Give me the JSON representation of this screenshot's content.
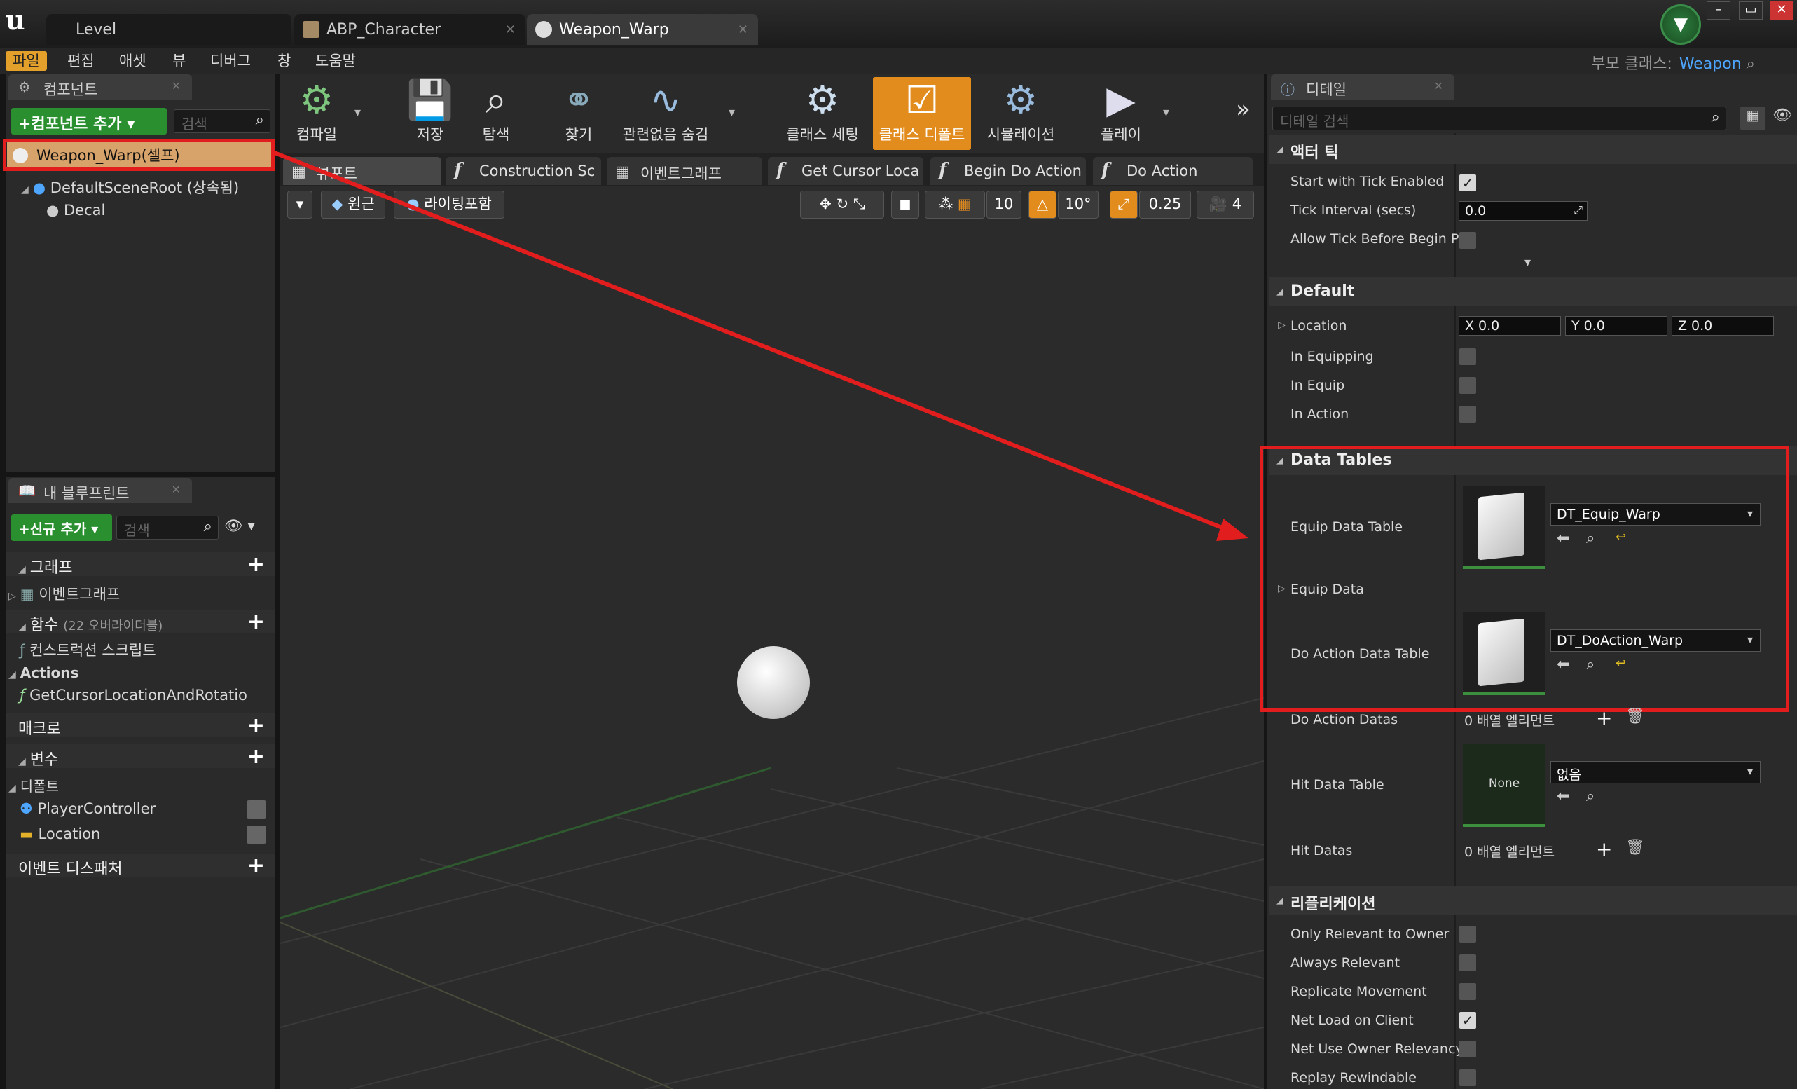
{
  "window": {
    "tabs": [
      {
        "label": "Level"
      },
      {
        "label": "ABP_Character"
      },
      {
        "label": "Weapon_Warp"
      }
    ],
    "parent_class_label": "부모 클래스:",
    "parent_class_value": "Weapon"
  },
  "menubar": [
    "파일",
    "편집",
    "애셋",
    "뷰",
    "디버그",
    "창",
    "도움말"
  ],
  "components": {
    "tab_title": "컴포넌트",
    "add_button": "+컴포넌트 추가",
    "search_placeholder": "검색",
    "items": [
      "Weapon_Warp(셀프)",
      "DefaultSceneRoot (상속됨)",
      "Decal"
    ]
  },
  "my_blueprint": {
    "tab_title": "내 블루프린트",
    "add_button": "+신규 추가",
    "search_placeholder": "검색",
    "graph_header": "그래프",
    "event_graph": "이벤트그래프",
    "functions_header": "함수",
    "functions_override": "(22 오버라이더블)",
    "construction_script": "컨스트럭션 스크립트",
    "actions_category": "Actions",
    "action_function": "GetCursorLocationAndRotatio",
    "macros_header": "매크로",
    "variables_header": "변수",
    "default_category": "디폴트",
    "variables": [
      "PlayerController",
      "Location"
    ],
    "dispatchers_header": "이벤트 디스패처"
  },
  "toolbar": {
    "items": [
      "컴파일",
      "저장",
      "탐색",
      "찾기",
      "관련없음 숨김",
      "클래스 세팅",
      "클래스 디폴트",
      "시뮬레이션",
      "플레이"
    ]
  },
  "graph_tabs": [
    "뷰포트",
    "Construction Sc",
    "이벤트그래프",
    "Get Cursor Loca",
    "Begin Do Action",
    "Do Action"
  ],
  "viewport_toolbar": {
    "perspective": "원근",
    "lighting": "라이팅포함",
    "grid_snap": "10",
    "rot_snap": "10°",
    "scale_snap": "0.25",
    "camera_speed": "4"
  },
  "details": {
    "tab_title": "디테일",
    "search_placeholder": "디테일 검색",
    "actor_tick_header": "액터 틱",
    "start_with_tick": "Start with Tick Enabled",
    "tick_interval_label": "Tick Interval (secs)",
    "tick_interval_value": "0.0",
    "allow_tick": "Allow Tick Before Begin Pla",
    "default_header": "Default",
    "location_label": "Location",
    "loc_x": "X 0.0",
    "loc_y": "Y 0.0",
    "loc_z": "Z 0.0",
    "in_equipping": "In Equipping",
    "in_equip": "In Equip",
    "in_action": "In Action",
    "data_tables_header": "Data Tables",
    "equip_data_table": "Equip Data Table",
    "equip_data_table_value": "DT_Equip_Warp",
    "equip_data": "Equip Data",
    "do_action_data_table": "Do Action Data Table",
    "do_action_data_table_value": "DT_DoAction_Warp",
    "do_action_datas": "Do Action Datas",
    "array_elements": "0 배열 엘리먼트",
    "hit_data_table": "Hit Data Table",
    "hit_none": "None",
    "hit_combo": "없음",
    "hit_datas": "Hit Datas",
    "hit_array_elements": "0 배열 엘리먼트",
    "replication_header": "리플리케이션",
    "only_relevant": "Only Relevant to Owner",
    "always_relevant": "Always Relevant",
    "replicate_movement": "Replicate Movement",
    "net_load": "Net Load on Client",
    "net_use_owner": "Net Use Owner Relevancy",
    "replay_rewindable": "Replay Rewindable"
  },
  "colors": {
    "accent_orange": "#e38c1e",
    "add_green": "#2a8f2f",
    "highlight_red": "#e21d1d",
    "link_blue": "#4ea6ff"
  }
}
